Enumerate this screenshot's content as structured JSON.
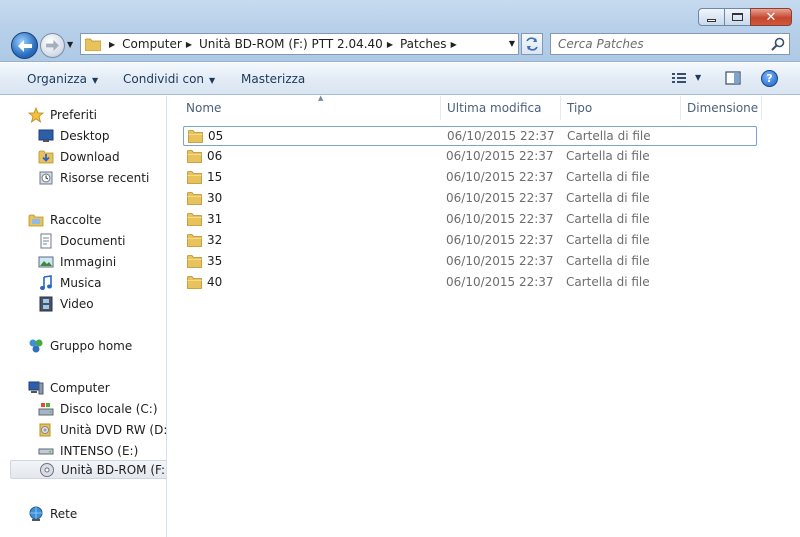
{
  "window": {
    "caption": {
      "minimize_glyph": "",
      "close_glyph": "✕"
    }
  },
  "address": {
    "crumbs": [
      "Computer",
      "Unità BD-ROM (F:) PTT 2.04.40",
      "Patches"
    ]
  },
  "search": {
    "placeholder": "Cerca Patches"
  },
  "toolbar": {
    "organize": "Organizza",
    "share": "Condividi con",
    "burn": "Masterizza",
    "help": "?"
  },
  "nav": {
    "favorites": "Preferiti",
    "desktop": "Desktop",
    "downloads": "Download",
    "recent": "Risorse recenti",
    "libraries": "Raccolte",
    "documents": "Documenti",
    "pictures": "Immagini",
    "music": "Musica",
    "video": "Video",
    "homegroup": "Gruppo home",
    "computer": "Computer",
    "drive_c": "Disco locale (C:)",
    "drive_d": "Unità DVD RW (D:) C",
    "drive_e": "INTENSO (E:)",
    "drive_f": "Unità BD-ROM (F:) P",
    "network": "Rete"
  },
  "columns": {
    "name": "Nome",
    "modified": "Ultima modifica",
    "type": "Tipo",
    "size": "Dimensione"
  },
  "files": [
    {
      "name": "05",
      "modified": "06/10/2015 22:37",
      "type": "Cartella di file"
    },
    {
      "name": "06",
      "modified": "06/10/2015 22:37",
      "type": "Cartella di file"
    },
    {
      "name": "15",
      "modified": "06/10/2015 22:37",
      "type": "Cartella di file"
    },
    {
      "name": "30",
      "modified": "06/10/2015 22:37",
      "type": "Cartella di file"
    },
    {
      "name": "31",
      "modified": "06/10/2015 22:37",
      "type": "Cartella di file"
    },
    {
      "name": "32",
      "modified": "06/10/2015 22:37",
      "type": "Cartella di file"
    },
    {
      "name": "35",
      "modified": "06/10/2015 22:37",
      "type": "Cartella di file"
    },
    {
      "name": "40",
      "modified": "06/10/2015 22:37",
      "type": "Cartella di file"
    }
  ],
  "icons": {
    "folder": "folder-icon",
    "colors": {
      "folder": "#e8c25a",
      "accent": "#1e395b",
      "selection_border": "#7da2ce"
    }
  }
}
